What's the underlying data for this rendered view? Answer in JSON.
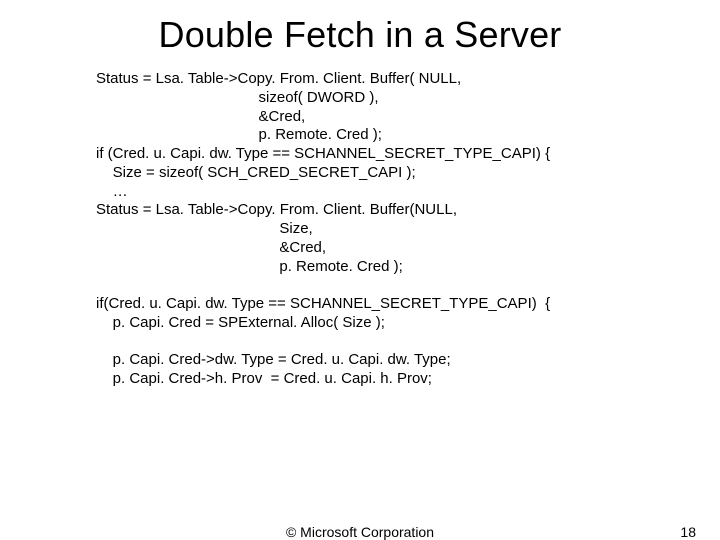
{
  "title": "Double Fetch in a Server",
  "code": "Status = Lsa. Table->Copy. From. Client. Buffer( NULL,\n                                       sizeof( DWORD ),\n                                       &Cred,\n                                       p. Remote. Cred );\nif (Cred. u. Capi. dw. Type == SCHANNEL_SECRET_TYPE_CAPI) {\n    Size = sizeof( SCH_CRED_SECRET_CAPI );\n    …\nStatus = Lsa. Table->Copy. From. Client. Buffer(NULL,\n                                            Size,\n                                            &Cred,\n                                            p. Remote. Cred );\n\nif(Cred. u. Capi. dw. Type == SCHANNEL_SECRET_TYPE_CAPI)  {\n    p. Capi. Cred = SPExternal. Alloc( Size );\n\n    p. Capi. Cred->dw. Type = Cred. u. Capi. dw. Type;\n    p. Capi. Cred->h. Prov  = Cred. u. Capi. h. Prov;",
  "footer": {
    "copyright": "© Microsoft Corporation",
    "page_number": "18"
  }
}
